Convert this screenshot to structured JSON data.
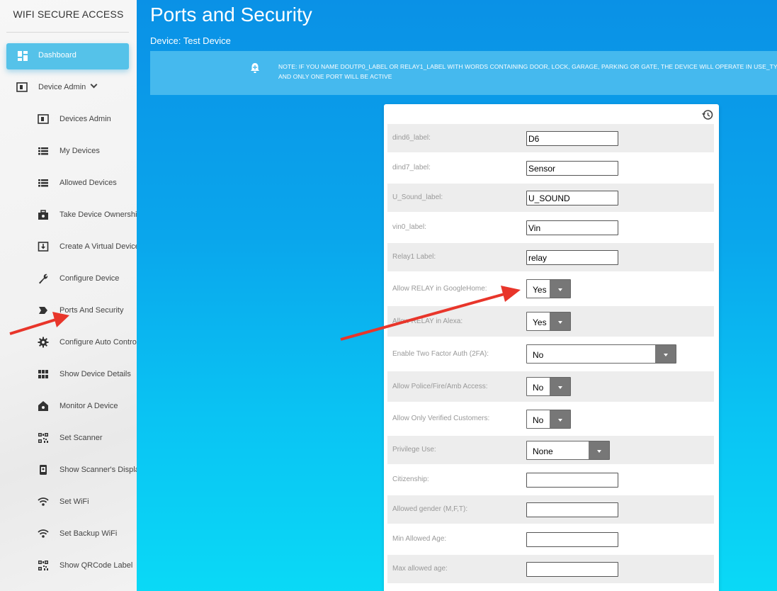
{
  "sidebar": {
    "brand": "WIFI SECURE ACCESS",
    "dashboard": "Dashboard",
    "device_admin": "Device Admin",
    "items": [
      {
        "label": "Devices Admin",
        "icon": "device-admin-icon"
      },
      {
        "label": "My Devices",
        "icon": "list-icon"
      },
      {
        "label": "Allowed Devices",
        "icon": "list-icon"
      },
      {
        "label": "Take Device Ownership",
        "icon": "briefcase-icon"
      },
      {
        "label": "Create A Virtual Device",
        "icon": "download-box-icon"
      },
      {
        "label": "Configure Device",
        "icon": "wrench-icon"
      },
      {
        "label": "Ports And Security",
        "icon": "label-tag-icon"
      },
      {
        "label": "Configure Auto Controls",
        "icon": "gear-icon"
      },
      {
        "label": "Show Device Details",
        "icon": "grid-icon"
      },
      {
        "label": "Monitor A Device",
        "icon": "home-icon"
      },
      {
        "label": "Set Scanner",
        "icon": "qrcode-icon"
      },
      {
        "label": "Show Scanner's Display",
        "icon": "phone-icon"
      },
      {
        "label": "Set WiFi",
        "icon": "wifi-icon"
      },
      {
        "label": "Set Backup WiFi",
        "icon": "wifi-icon"
      },
      {
        "label": "Show QRCode Label",
        "icon": "qrcode-icon"
      }
    ]
  },
  "main": {
    "title": "Ports and Security",
    "device_line": "Device: Test Device",
    "note_line1": "NOTE: IF YOU NAME DOUTP0_LABEL OR RELAY1_LABEL WITH WORDS CONTAINING DOOR, LOCK, GARAGE, PARKING OR GATE, THE DEVICE WILL OPERATE IN USE_TYPE AS E",
    "note_line2": "AND ONLY ONE PORT WILL BE ACTIVE"
  },
  "form": {
    "rows": [
      {
        "label": "dind6_label:",
        "type": "text",
        "value": "D6"
      },
      {
        "label": "dind7_label:",
        "type": "text",
        "value": "Sensor"
      },
      {
        "label": "U_Sound_label:",
        "type": "text",
        "value": "U_SOUND"
      },
      {
        "label": "vin0_label:",
        "type": "text",
        "value": "Vin"
      },
      {
        "label": "Relay1 Label:",
        "type": "text",
        "value": "relay"
      },
      {
        "label": "Allow RELAY in GoogleHome:",
        "type": "select",
        "value": "Yes"
      },
      {
        "label": "Allow RELAY in Alexa:",
        "type": "select",
        "value": "Yes"
      },
      {
        "label": "Enable Two Factor Auth (2FA):",
        "type": "select",
        "value": "No"
      },
      {
        "label": "Allow Police/Fire/Amb Access:",
        "type": "select",
        "value": "No"
      },
      {
        "label": "Allow Only Verified Customers:",
        "type": "select",
        "value": "No"
      },
      {
        "label": "Privilege Use:",
        "type": "select",
        "value": "None"
      },
      {
        "label": "Citizenship:",
        "type": "text",
        "value": ""
      },
      {
        "label": "Allowed gender (M,F,T):",
        "type": "text",
        "value": ""
      },
      {
        "label": "Min Allowed Age:",
        "type": "text",
        "value": ""
      },
      {
        "label": "Max allowed age:",
        "type": "text",
        "value": ""
      }
    ]
  },
  "colors": {
    "accent": "#55c2e9",
    "annotation_arrow": "#e8352a",
    "main_bg_top": "#0a91e6",
    "main_bg_bottom": "#0ad9f6"
  }
}
